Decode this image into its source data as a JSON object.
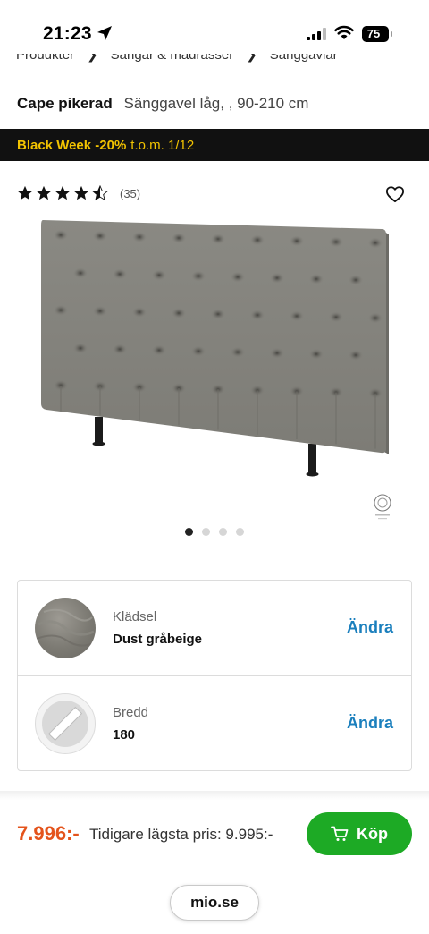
{
  "status_bar": {
    "time": "21:23",
    "battery": "75"
  },
  "breadcrumb": {
    "items": [
      "Produkter",
      "Sängar & madrasser",
      "Sänggavlar"
    ]
  },
  "product": {
    "name": "Cape pikerad",
    "subtitle": "Sänggavel låg, , 90-210 cm",
    "rating": 4.5,
    "review_count": "(35)"
  },
  "promo": {
    "highlight": "Black Week -20%",
    "rest": "t.o.m. 1/12"
  },
  "carousel": {
    "total": 4,
    "active_index": 0
  },
  "options": [
    {
      "label": "Klädsel",
      "value": "Dust gråbeige",
      "action": "Ändra",
      "thumb_icon": "fabric-swatch-icon"
    },
    {
      "label": "Bredd",
      "value": "180",
      "action": "Ändra",
      "thumb_icon": "width-ruler-icon"
    }
  ],
  "purchase": {
    "price": "7.996:-",
    "previous_price": "Tidigare lägsta pris: 9.995:-",
    "buy_label": "Köp"
  },
  "browser": {
    "url": "mio.se"
  },
  "colors": {
    "promo_bg": "#111111",
    "promo_text": "#f2c300",
    "price": "#e4531b",
    "buy_button": "#1daa25",
    "link": "#1a7fbd"
  }
}
